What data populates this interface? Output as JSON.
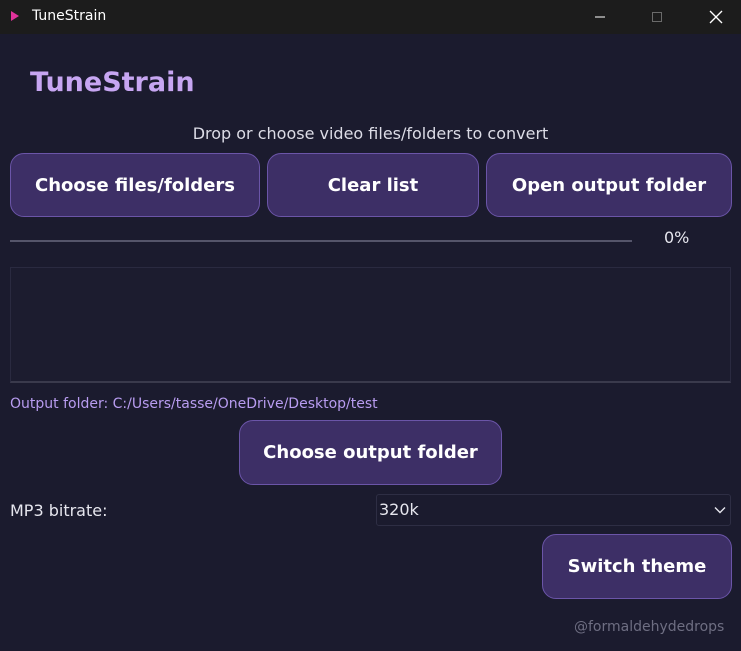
{
  "window": {
    "title": "TuneStrain",
    "app_icon": "play-icon",
    "controls": [
      "minimize-icon",
      "maximize-icon",
      "close-icon"
    ]
  },
  "app": {
    "title": "TuneStrain",
    "hint": "Drop or choose video files/folders to convert"
  },
  "buttons": {
    "choose_files": "Choose files/folders",
    "clear_list": "Clear list",
    "open_output": "Open output folder",
    "choose_output": "Choose output folder",
    "switch_theme": "Switch theme"
  },
  "progress": {
    "value": 0,
    "text": "0%"
  },
  "file_list": [],
  "output": {
    "label": "Output folder: C:/Users/tasse/OneDrive/Desktop/test"
  },
  "bitrate": {
    "label": "MP3 bitrate:",
    "selected": "320k"
  },
  "credit": "@formaldehydedrops",
  "colors": {
    "background": "#1b1b2e",
    "accent": "#c7a6f2",
    "button_bg": "#3d2f66",
    "button_border": "#6b55a8",
    "titlebar": "#1c1c1c",
    "app_icon": "#e0329b"
  }
}
